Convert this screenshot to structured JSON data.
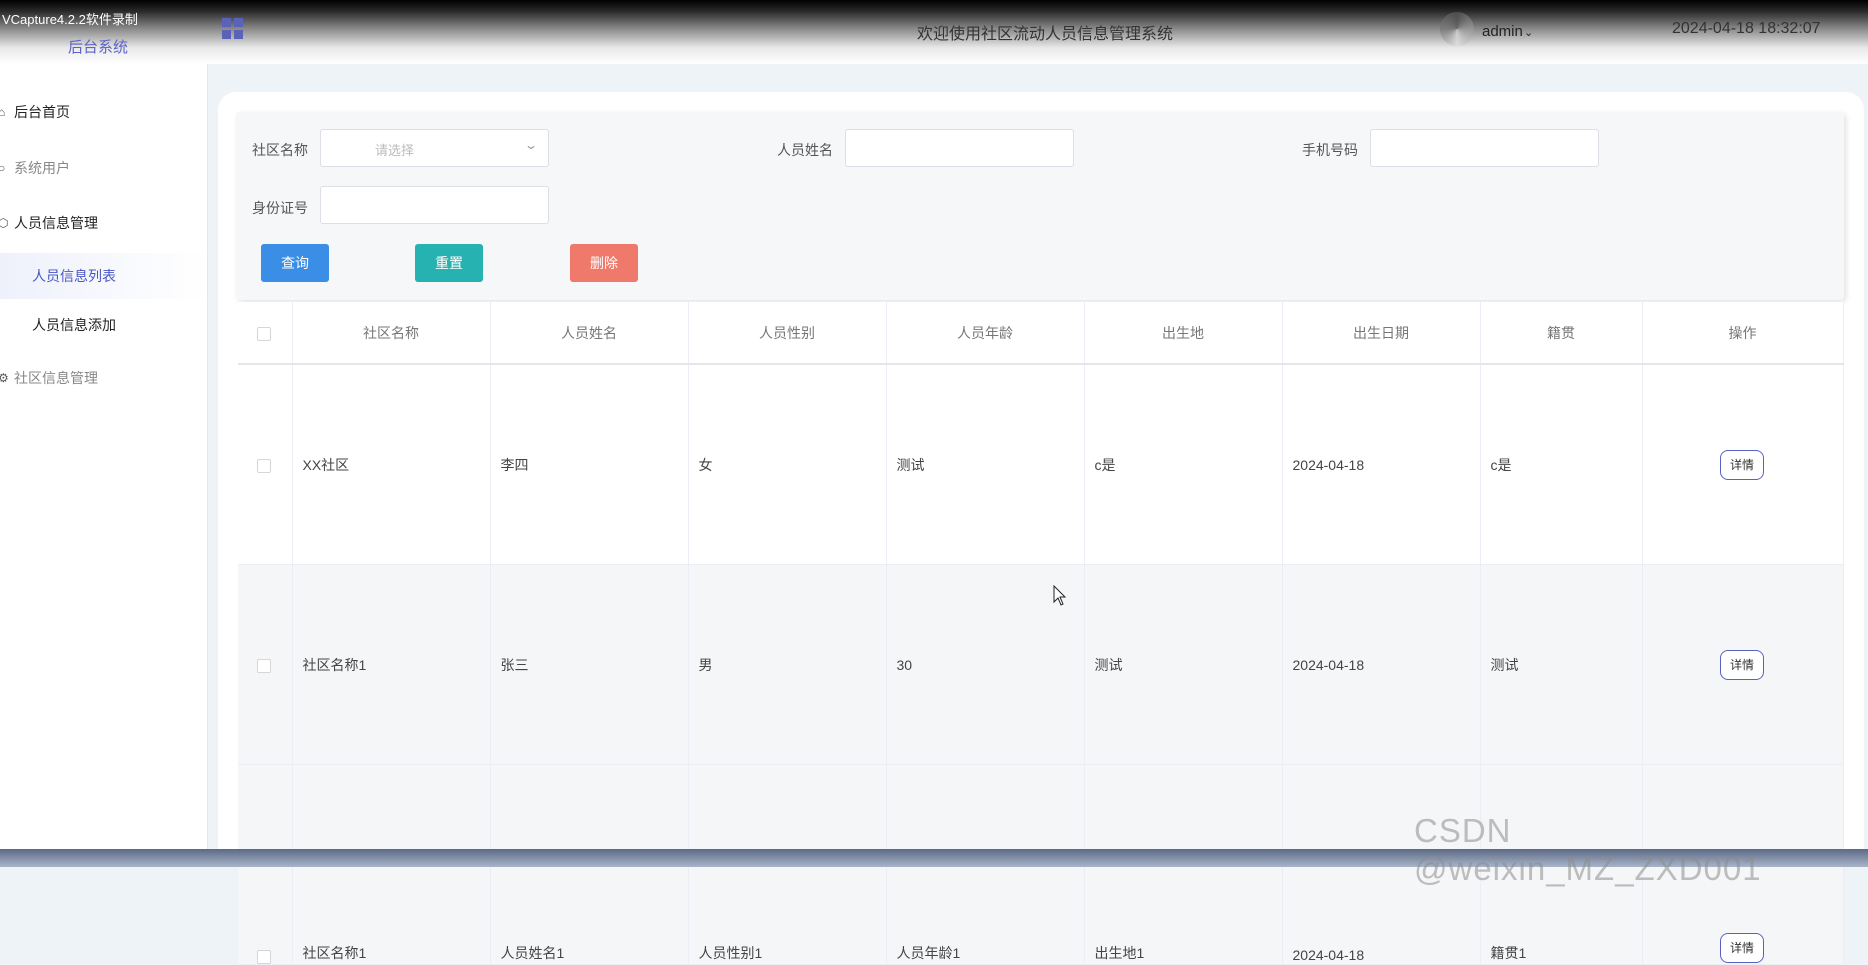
{
  "recorder_watermark": "VCapture4.2.2软件录制",
  "header": {
    "logo_text": "后台系统",
    "title": "欢迎使用社区流动人员信息管理系统",
    "username": "admin",
    "datetime": "2024-04-18 18:32:07"
  },
  "sidebar": {
    "items": [
      {
        "label": "后台首页"
      },
      {
        "label": "系统用户"
      },
      {
        "label": "人员信息管理"
      },
      {
        "label": "人员信息列表"
      },
      {
        "label": "人员信息添加"
      },
      {
        "label": "社区信息管理"
      }
    ]
  },
  "search": {
    "community_label": "社区名称",
    "community_placeholder": "请选择",
    "name_label": "人员姓名",
    "phone_label": "手机号码",
    "id_label": "身份证号",
    "query_button": "查询",
    "reset_button": "重置",
    "delete_button": "删除"
  },
  "colors": {
    "query": "#3a8ee6",
    "reset": "#26b2b0",
    "delete": "#ef7a6c",
    "accent": "#4a57c2"
  },
  "table": {
    "headers": [
      "社区名称",
      "人员姓名",
      "人员性别",
      "人员年龄",
      "出生地",
      "出生日期",
      "籍贯",
      "操作"
    ],
    "rows": [
      {
        "cells": [
          "XX社区",
          "李四",
          "女",
          "测试",
          "c是",
          "2024-04-18",
          "c是"
        ],
        "action": "详情"
      },
      {
        "cells": [
          "社区名称1",
          "张三",
          "男",
          "30",
          "测试",
          "2024-04-18",
          "测试"
        ],
        "action": "详情"
      },
      {
        "cells": [
          "社区名称1",
          "人员姓名1",
          "人员性别1",
          "人员年龄1",
          "出生地1",
          "2024-04-18",
          "籍贯1"
        ],
        "action": "详情"
      }
    ]
  },
  "csdn_watermark": "CSDN @weixin_MZ_ZXD001"
}
